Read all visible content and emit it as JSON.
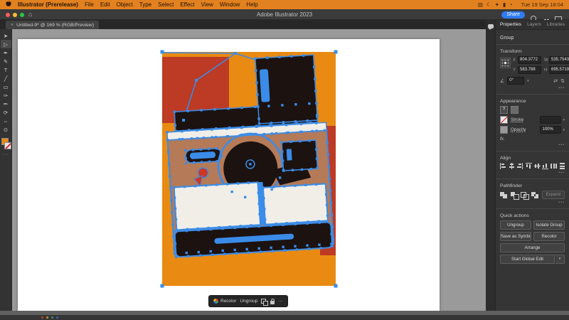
{
  "menubar": {
    "items": [
      "Illustrator (Prerelease)",
      "File",
      "Edit",
      "Object",
      "Type",
      "Select",
      "Effect",
      "View",
      "Window",
      "Help"
    ],
    "status_icons": [
      "▤",
      "☾",
      "✦",
      "▮",
      "◔"
    ],
    "time": "Tue 19 Sep 18:04"
  },
  "titlebar": {
    "title": "Adobe Illustrator 2023",
    "share_label": "Share"
  },
  "tabbar": {
    "close_label": "×",
    "title": "Untitled-9* @ 169 % (RGB/Preview)"
  },
  "toolbar": {
    "tools": [
      {
        "name": "selection-tool-icon",
        "glyph": "➤"
      },
      {
        "name": "direct-selection-tool-icon",
        "glyph": "▷"
      },
      {
        "name": "pen-tool-icon",
        "glyph": "✒"
      },
      {
        "name": "curvature-tool-icon",
        "glyph": "✎"
      },
      {
        "name": "type-tool-icon",
        "glyph": "T"
      },
      {
        "name": "line-tool-icon",
        "glyph": "╱"
      },
      {
        "name": "rectangle-tool-icon",
        "glyph": "▭"
      },
      {
        "name": "paintbrush-tool-icon",
        "glyph": "✑"
      },
      {
        "name": "shaper-tool-icon",
        "glyph": "✏"
      },
      {
        "name": "rotate-tool-icon",
        "glyph": "⟳"
      },
      {
        "name": "scale-tool-icon",
        "glyph": "⇔"
      },
      {
        "name": "zoom-tool-icon",
        "glyph": "⊙"
      }
    ],
    "more_label": "···"
  },
  "context_bar": {
    "recolor_label": "Recolor",
    "ungroup_label": "Ungroup",
    "more_label": "···"
  },
  "panel": {
    "tabs": [
      "Properties",
      "Layers",
      "Libraries"
    ],
    "selection_label": "Group",
    "transform": {
      "title": "Transform",
      "labels": {
        "x": "X",
        "y": "Y",
        "w": "W",
        "h": "H"
      },
      "x": "804.3772",
      "y": "583.788",
      "w": "535.7543",
      "h": "695.5719",
      "angle_glyph": "∠",
      "angle": "0°",
      "flip_h": "⇄",
      "flip_v": "⇅",
      "caret": "▾",
      "more": "•••"
    },
    "appearance": {
      "title": "Appearance",
      "fill_unknown": "?",
      "stroke_label": "Stroke",
      "opacity_label": "Opacity",
      "opacity_value": "100%",
      "fx_label": "fx.",
      "caret": "▾",
      "more": "•••"
    },
    "align": {
      "title": "Align",
      "more": "•••"
    },
    "pathfinder": {
      "title": "Pathfinder",
      "expand_label": "Expand",
      "more": "•••"
    },
    "quick_actions": {
      "title": "Quick actions",
      "buttons": [
        "Ungroup",
        "Isolate Group",
        "Save as Symbol",
        "Recolor",
        "Arrange",
        "Start Global Edit"
      ],
      "dropdown_glyph": "▾"
    }
  },
  "artwork": {
    "colors": {
      "background": "#e98a12",
      "dark_red": "#bd3a24",
      "black": "#1c1210",
      "white": "#f1eee8",
      "tan": "#b57a57",
      "selection_blue": "#3a8ce8",
      "accent_red": "#cf3520"
    }
  }
}
